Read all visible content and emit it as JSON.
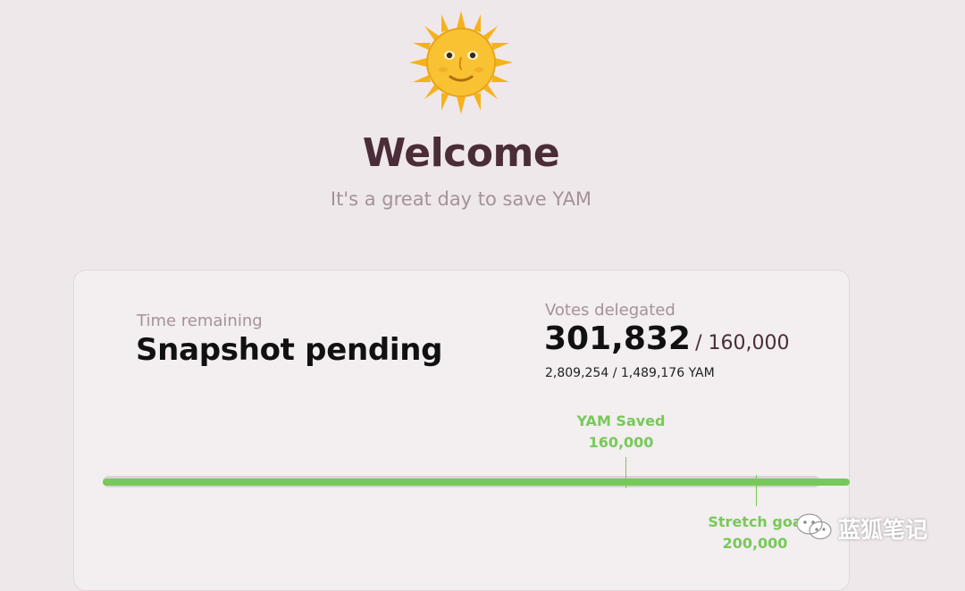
{
  "hero": {
    "icon": "sun-with-face-icon",
    "title": "Welcome",
    "subtitle": "It's a great day to save YAM"
  },
  "card": {
    "time": {
      "label": "Time remaining",
      "value": "Snapshot pending"
    },
    "votes": {
      "label": "Votes delegated",
      "current": "301,832",
      "target": "/ 160,000",
      "yam": "2,809,254 / 1,489,176 YAM"
    },
    "progress": {
      "fraction": 1.0,
      "milestones": [
        {
          "label": "YAM Saved",
          "value": "160,000"
        },
        {
          "label": "Stretch goa",
          "value": "200,000"
        }
      ]
    }
  },
  "watermark": {
    "icon": "wechat-icon",
    "text": "蓝狐笔记"
  },
  "colors": {
    "background": "#efe8ea",
    "accent_green": "#77c95a",
    "title": "#4a2d38",
    "muted": "#a39397"
  }
}
